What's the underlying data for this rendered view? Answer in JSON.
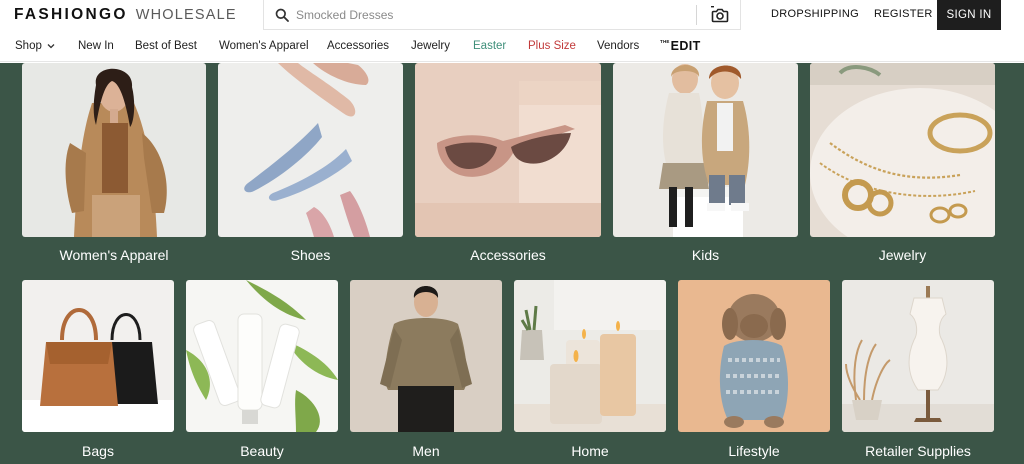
{
  "header": {
    "logo_main": "FASHIONGO",
    "logo_sub": "WHOLESALE",
    "search_placeholder": "Smocked Dresses",
    "dropshipping": "DROPSHIPPING",
    "register": "REGISTER",
    "sign_in": "SIGN IN"
  },
  "nav": {
    "shop": "Shop",
    "new_in": "New In",
    "best_of_best": "Best of Best",
    "womens_apparel": "Women's Apparel",
    "accessories": "Accessories",
    "jewelry": "Jewelry",
    "easter": "Easter",
    "plus_size": "Plus Size",
    "vendors": "Vendors",
    "edit_the": "THE",
    "edit_word": "EDIT"
  },
  "categories_row1": [
    {
      "label": "Women's Apparel"
    },
    {
      "label": "Shoes"
    },
    {
      "label": "Accessories"
    },
    {
      "label": "Kids"
    },
    {
      "label": "Jewelry"
    }
  ],
  "categories_row2": [
    {
      "label": "Bags"
    },
    {
      "label": "Beauty"
    },
    {
      "label": "Men"
    },
    {
      "label": "Home"
    },
    {
      "label": "Lifestyle"
    },
    {
      "label": "Retailer Supplies"
    }
  ],
  "colors": {
    "background_green": "#3b5547",
    "easter": "#3f8f7a",
    "plus_size": "#c23a3a",
    "sign_in_bg": "#1e1e1e"
  }
}
